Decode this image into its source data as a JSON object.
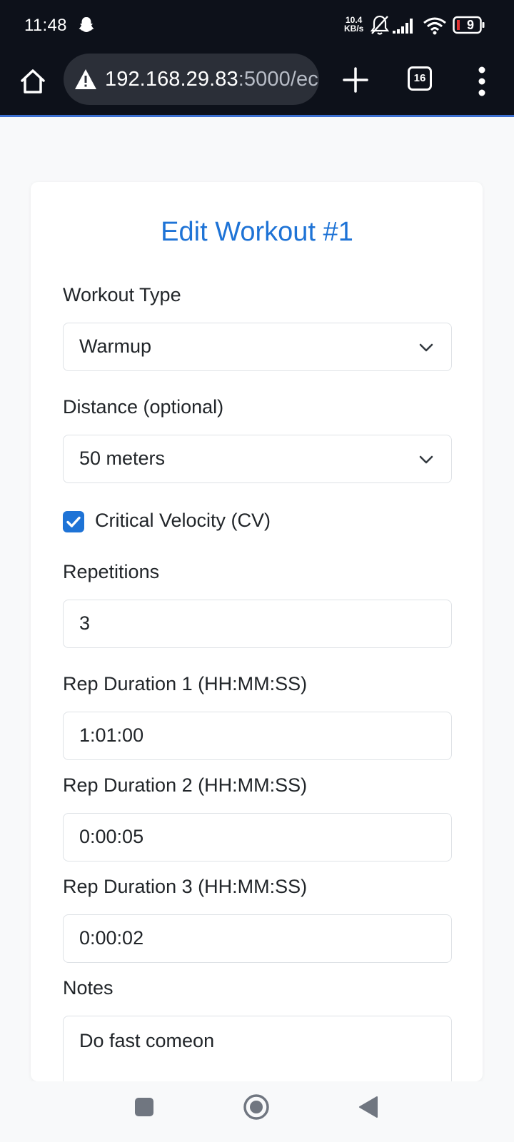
{
  "status_bar": {
    "time": "11:48",
    "net_speed_value": "10.4",
    "net_speed_unit": "KB/s",
    "battery": "9"
  },
  "browser": {
    "url_host": "192.168.29.83",
    "url_rest": ":5000/ec",
    "tab_count": "16"
  },
  "form": {
    "title": "Edit Workout #1",
    "workout_type_label": "Workout Type",
    "workout_type_value": "Warmup",
    "distance_label": "Distance (optional)",
    "distance_value": "50 meters",
    "cv_label": "Critical Velocity (CV)",
    "cv_checked": true,
    "repetitions_label": "Repetitions",
    "repetitions_value": "3",
    "reps": [
      {
        "label": "Rep Duration 1 (HH:MM:SS)",
        "value": "1:01:00"
      },
      {
        "label": "Rep Duration 2 (HH:MM:SS)",
        "value": "0:00:05"
      },
      {
        "label": "Rep Duration 3 (HH:MM:SS)",
        "value": "0:00:02"
      }
    ],
    "notes_label": "Notes",
    "notes_value": "Do fast comeon"
  },
  "colors": {
    "accent": "#1e73d6",
    "status_bar_bg": "#0d111a",
    "page_bg": "#f8f9fa"
  },
  "icons": {
    "snapchat": "snapchat-ghost-icon",
    "mute": "bell-off-icon",
    "signal": "signal-bars-icon",
    "wifi": "wifi-icon",
    "battery": "battery-icon",
    "home": "home-icon",
    "warning": "warning-icon",
    "new_tab": "plus-icon",
    "menu": "more-vert-icon",
    "recents": "square-icon",
    "home_nav": "circle-icon",
    "back": "triangle-back-icon"
  }
}
